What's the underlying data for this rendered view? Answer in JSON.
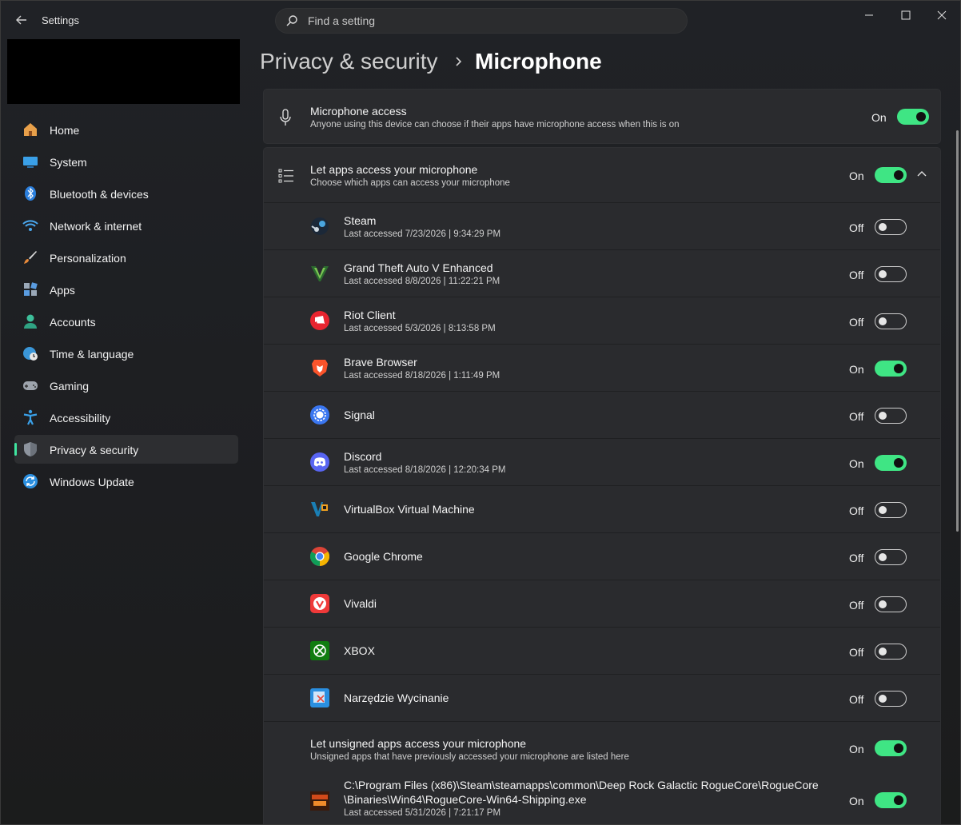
{
  "window": {
    "title": "Settings"
  },
  "search": {
    "placeholder": "Find a setting"
  },
  "sidebar": {
    "items": [
      {
        "label": "Home",
        "icon": "home-icon"
      },
      {
        "label": "System",
        "icon": "system-icon"
      },
      {
        "label": "Bluetooth & devices",
        "icon": "bluetooth-icon"
      },
      {
        "label": "Network & internet",
        "icon": "wifi-icon"
      },
      {
        "label": "Personalization",
        "icon": "brush-icon"
      },
      {
        "label": "Apps",
        "icon": "apps-icon"
      },
      {
        "label": "Accounts",
        "icon": "person-icon"
      },
      {
        "label": "Time & language",
        "icon": "globe-clock-icon"
      },
      {
        "label": "Gaming",
        "icon": "gamepad-icon"
      },
      {
        "label": "Accessibility",
        "icon": "accessibility-icon"
      },
      {
        "label": "Privacy & security",
        "icon": "shield-icon",
        "active": true
      },
      {
        "label": "Windows Update",
        "icon": "update-icon"
      }
    ]
  },
  "breadcrumb": {
    "parent": "Privacy & security",
    "current": "Microphone"
  },
  "mic_access": {
    "title": "Microphone access",
    "subtitle": "Anyone using this device can choose if their apps have microphone access when this is on",
    "state": "On"
  },
  "apps_access": {
    "title": "Let apps access your microphone",
    "subtitle": "Choose which apps can access your microphone",
    "state": "On"
  },
  "apps": [
    {
      "name": "Steam",
      "detail": "Last accessed 7/23/2026  |  9:34:29 PM",
      "state": "Off",
      "icon": "steam-icon"
    },
    {
      "name": "Grand Theft Auto V Enhanced",
      "detail": "Last accessed 8/8/2026  |  11:22:21 PM",
      "state": "Off",
      "icon": "gta-icon"
    },
    {
      "name": "Riot Client",
      "detail": "Last accessed 5/3/2026  |  8:13:58 PM",
      "state": "Off",
      "icon": "riot-icon"
    },
    {
      "name": "Brave Browser",
      "detail": "Last accessed 8/18/2026  |  1:11:49 PM",
      "state": "On",
      "icon": "brave-icon"
    },
    {
      "name": "Signal",
      "detail": "",
      "state": "Off",
      "icon": "signal-icon"
    },
    {
      "name": "Discord",
      "detail": "Last accessed 8/18/2026  |  12:20:34 PM",
      "state": "On",
      "icon": "discord-icon"
    },
    {
      "name": "VirtualBox Virtual Machine",
      "detail": "",
      "state": "Off",
      "icon": "virtualbox-icon"
    },
    {
      "name": "Google Chrome",
      "detail": "",
      "state": "Off",
      "icon": "chrome-icon"
    },
    {
      "name": "Vivaldi",
      "detail": "",
      "state": "Off",
      "icon": "vivaldi-icon"
    },
    {
      "name": "XBOX",
      "detail": "",
      "state": "Off",
      "icon": "xbox-icon"
    },
    {
      "name": "Narzędzie Wycinanie",
      "detail": "",
      "state": "Off",
      "icon": "snipping-tool-icon"
    }
  ],
  "unsigned": {
    "title": "Let unsigned apps access your microphone",
    "subtitle": "Unsigned apps that have previously accessed your microphone are listed here",
    "state": "On"
  },
  "unsigned_app": {
    "path_line1": "C:\\Program Files (x86)\\Steam\\steamapps\\common\\Deep Rock Galactic RogueCore\\RogueCore",
    "path_line2": "\\Binaries\\Win64\\RogueCore-Win64-Shipping.exe",
    "detail": "Last accessed 5/31/2026  |  7:21:17 PM",
    "state": "On",
    "icon": "roguecore-icon"
  },
  "colors": {
    "accent": "#3fe584",
    "background": "#1c1d20",
    "card": "#2a2b2e"
  }
}
